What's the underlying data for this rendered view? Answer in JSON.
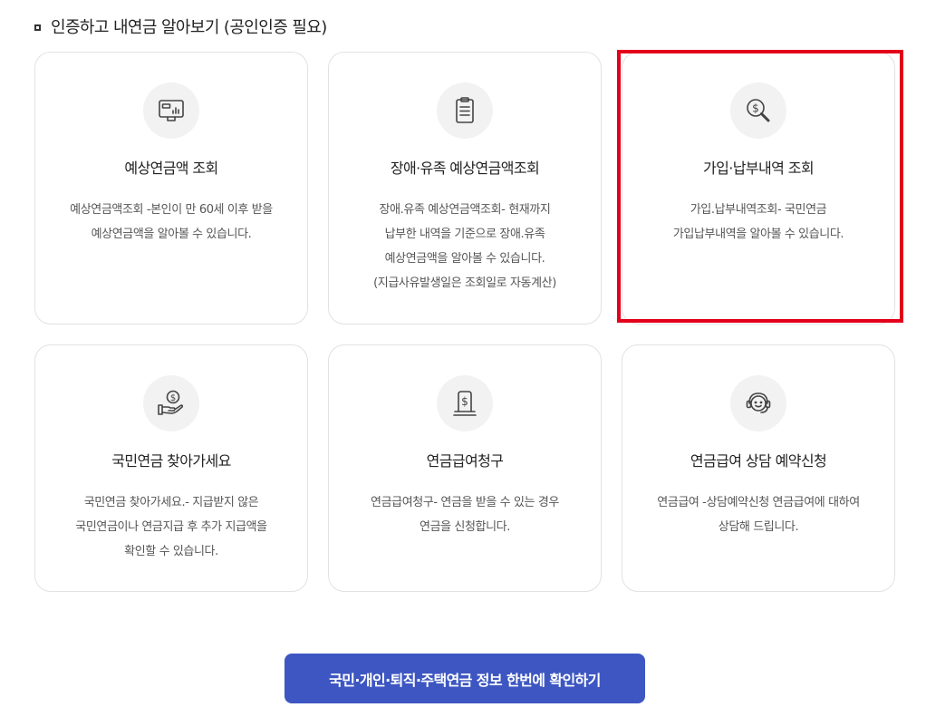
{
  "section": {
    "title": "인증하고 내연금 알아보기 (공인인증 필요)"
  },
  "cards": [
    {
      "title": "예상연금액 조회",
      "icon": "monitor-chart-icon",
      "desc": [
        "예상연금액조회 -본인이 만 60세 이후 받을",
        "예상연금액을 알아볼 수 있습니다."
      ]
    },
    {
      "title": "장애·유족 예상연금액조회",
      "icon": "clipboard-icon",
      "desc": [
        "장애.유족 예상연금액조회- 현재까지",
        "납부한 내역을 기준으로 장애.유족",
        "예상연금액을 알아볼 수 있습니다.",
        "(지급사유발생일은 조회일로 자동계산)"
      ]
    },
    {
      "title": "가입·납부내역 조회",
      "icon": "dollar-search-icon",
      "desc": [
        "가입.납부내역조회- 국민연금",
        "가입납부내역을 알아볼 수 있습니다."
      ]
    },
    {
      "title": "국민연금 찾아가세요",
      "icon": "hand-coin-icon",
      "desc": [
        "국민연금 찾아가세요.- 지급받지 않은",
        "국민연금이나 연금지급 후 추가 지급액을",
        "확인할 수 있습니다."
      ]
    },
    {
      "title": "연금급여청구",
      "icon": "dollar-document-icon",
      "desc": [
        "연금급여청구- 연금을 받을 수 있는 경우",
        "연금을 신청합니다."
      ]
    },
    {
      "title": "연금급여 상담 예약신청",
      "icon": "headset-icon",
      "desc": [
        "연금급여 -상담예약신청 연금급여에 대하여",
        "상담해 드립니다."
      ]
    }
  ],
  "cta": {
    "label": "국민·개인·퇴직·주택연금 정보 한번에 확인하기"
  },
  "colors": {
    "accent": "#3d56c2",
    "highlight": "#e3001b"
  }
}
